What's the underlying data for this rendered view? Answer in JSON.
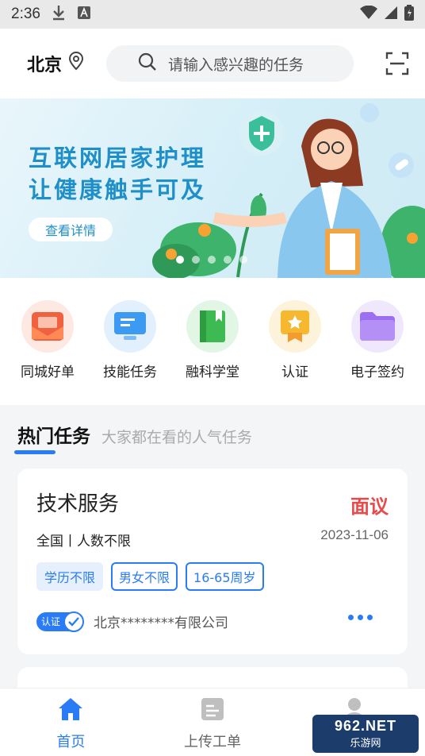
{
  "status_bar": {
    "time": "2:36"
  },
  "header": {
    "city": "北京",
    "search_placeholder": "请输入感兴趣的任务"
  },
  "banner": {
    "line1": "互联网居家护理",
    "line2": "让健康触手可及",
    "button": "查看详情"
  },
  "quick_icons": [
    {
      "label": "同城好单",
      "icon": "mail-icon",
      "color": "#f0623f",
      "bg": "#fde8e2"
    },
    {
      "label": "技能任务",
      "icon": "monitor-icon",
      "color": "#3c9af2",
      "bg": "#e2effd"
    },
    {
      "label": "融科学堂",
      "icon": "book-icon",
      "color": "#3dbb52",
      "bg": "#e2f6e5"
    },
    {
      "label": "认证",
      "icon": "certificate-icon",
      "color": "#f5b82e",
      "bg": "#fdf3da"
    },
    {
      "label": "电子签约",
      "icon": "folder-icon",
      "color": "#9b6ef2",
      "bg": "#efe8fd"
    }
  ],
  "hot_section": {
    "title": "热门任务",
    "subtitle": "大家都在看的人气任务"
  },
  "task_card": {
    "title": "技术服务",
    "price": "面议",
    "meta": "全国丨人数不限",
    "date": "2023-11-06",
    "tags": [
      "学历不限",
      "男女不限",
      "16-65周岁"
    ],
    "verified_label": "认证",
    "company": "北京********有限公司"
  },
  "tabbar": {
    "home": "首页",
    "upload": "上传工单",
    "profile": "我的"
  },
  "watermark": {
    "brand": "962.NET",
    "sub": "乐游网"
  }
}
